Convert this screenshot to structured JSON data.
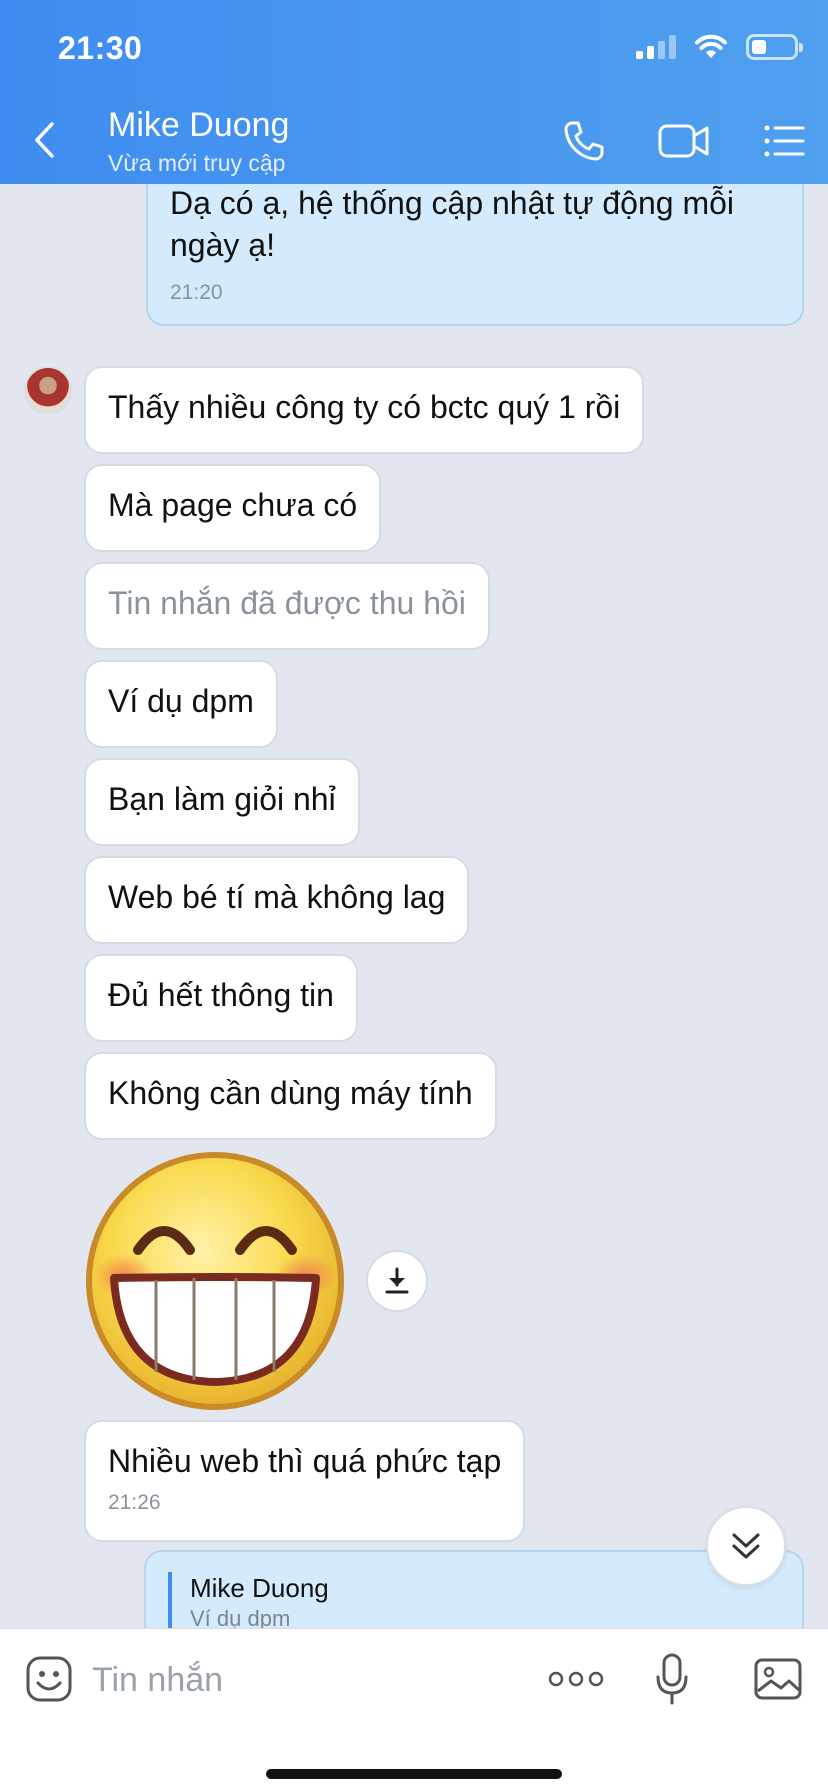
{
  "status_bar": {
    "time": "21:30"
  },
  "header": {
    "contact_name": "Mike Duong",
    "contact_status": "Vừa mới truy cập",
    "icons": [
      "back-arrow-icon",
      "phone-icon",
      "video-camera-icon",
      "list-menu-icon"
    ]
  },
  "messages": [
    {
      "from": "me",
      "text_line1": "Dạ có ạ, hệ thống cập nhật tự động mỗi",
      "text_line2": "ngày ạ!",
      "time": "21:20"
    },
    {
      "from": "contact",
      "text": "Thấy nhiều công ty có bctc quý 1 rồi"
    },
    {
      "from": "contact",
      "text": "Mà page chưa có"
    },
    {
      "from": "contact",
      "text": "Tin nhắn đã được thu hồi",
      "recalled": true
    },
    {
      "from": "contact",
      "text": "Ví dụ dpm"
    },
    {
      "from": "contact",
      "text": "Bạn làm giỏi nhỉ"
    },
    {
      "from": "contact",
      "text": "Web bé tí mà không lag"
    },
    {
      "from": "contact",
      "text": "Đủ hết thông tin"
    },
    {
      "from": "contact",
      "text": "Không cần dùng máy tính"
    },
    {
      "from": "contact",
      "sticker": "grinning-face-sticker"
    },
    {
      "from": "contact",
      "text": "Nhiều web thì quá phức tạp",
      "time": "21:26"
    }
  ],
  "reply_preview": {
    "author": "Mike Duong",
    "quoted_text": "Ví dụ dpm"
  },
  "input_bar": {
    "placeholder": "Tin nhắn",
    "icons": [
      "emoji-icon",
      "more-options-icon",
      "microphone-icon",
      "image-icon"
    ]
  },
  "colors": {
    "header_start": "#3f8cf0",
    "header_end": "#4fa0ef",
    "chat_background": "#e2e7ef",
    "my_bubble": "#d4ebfd",
    "their_bubble": "#ffffff"
  }
}
